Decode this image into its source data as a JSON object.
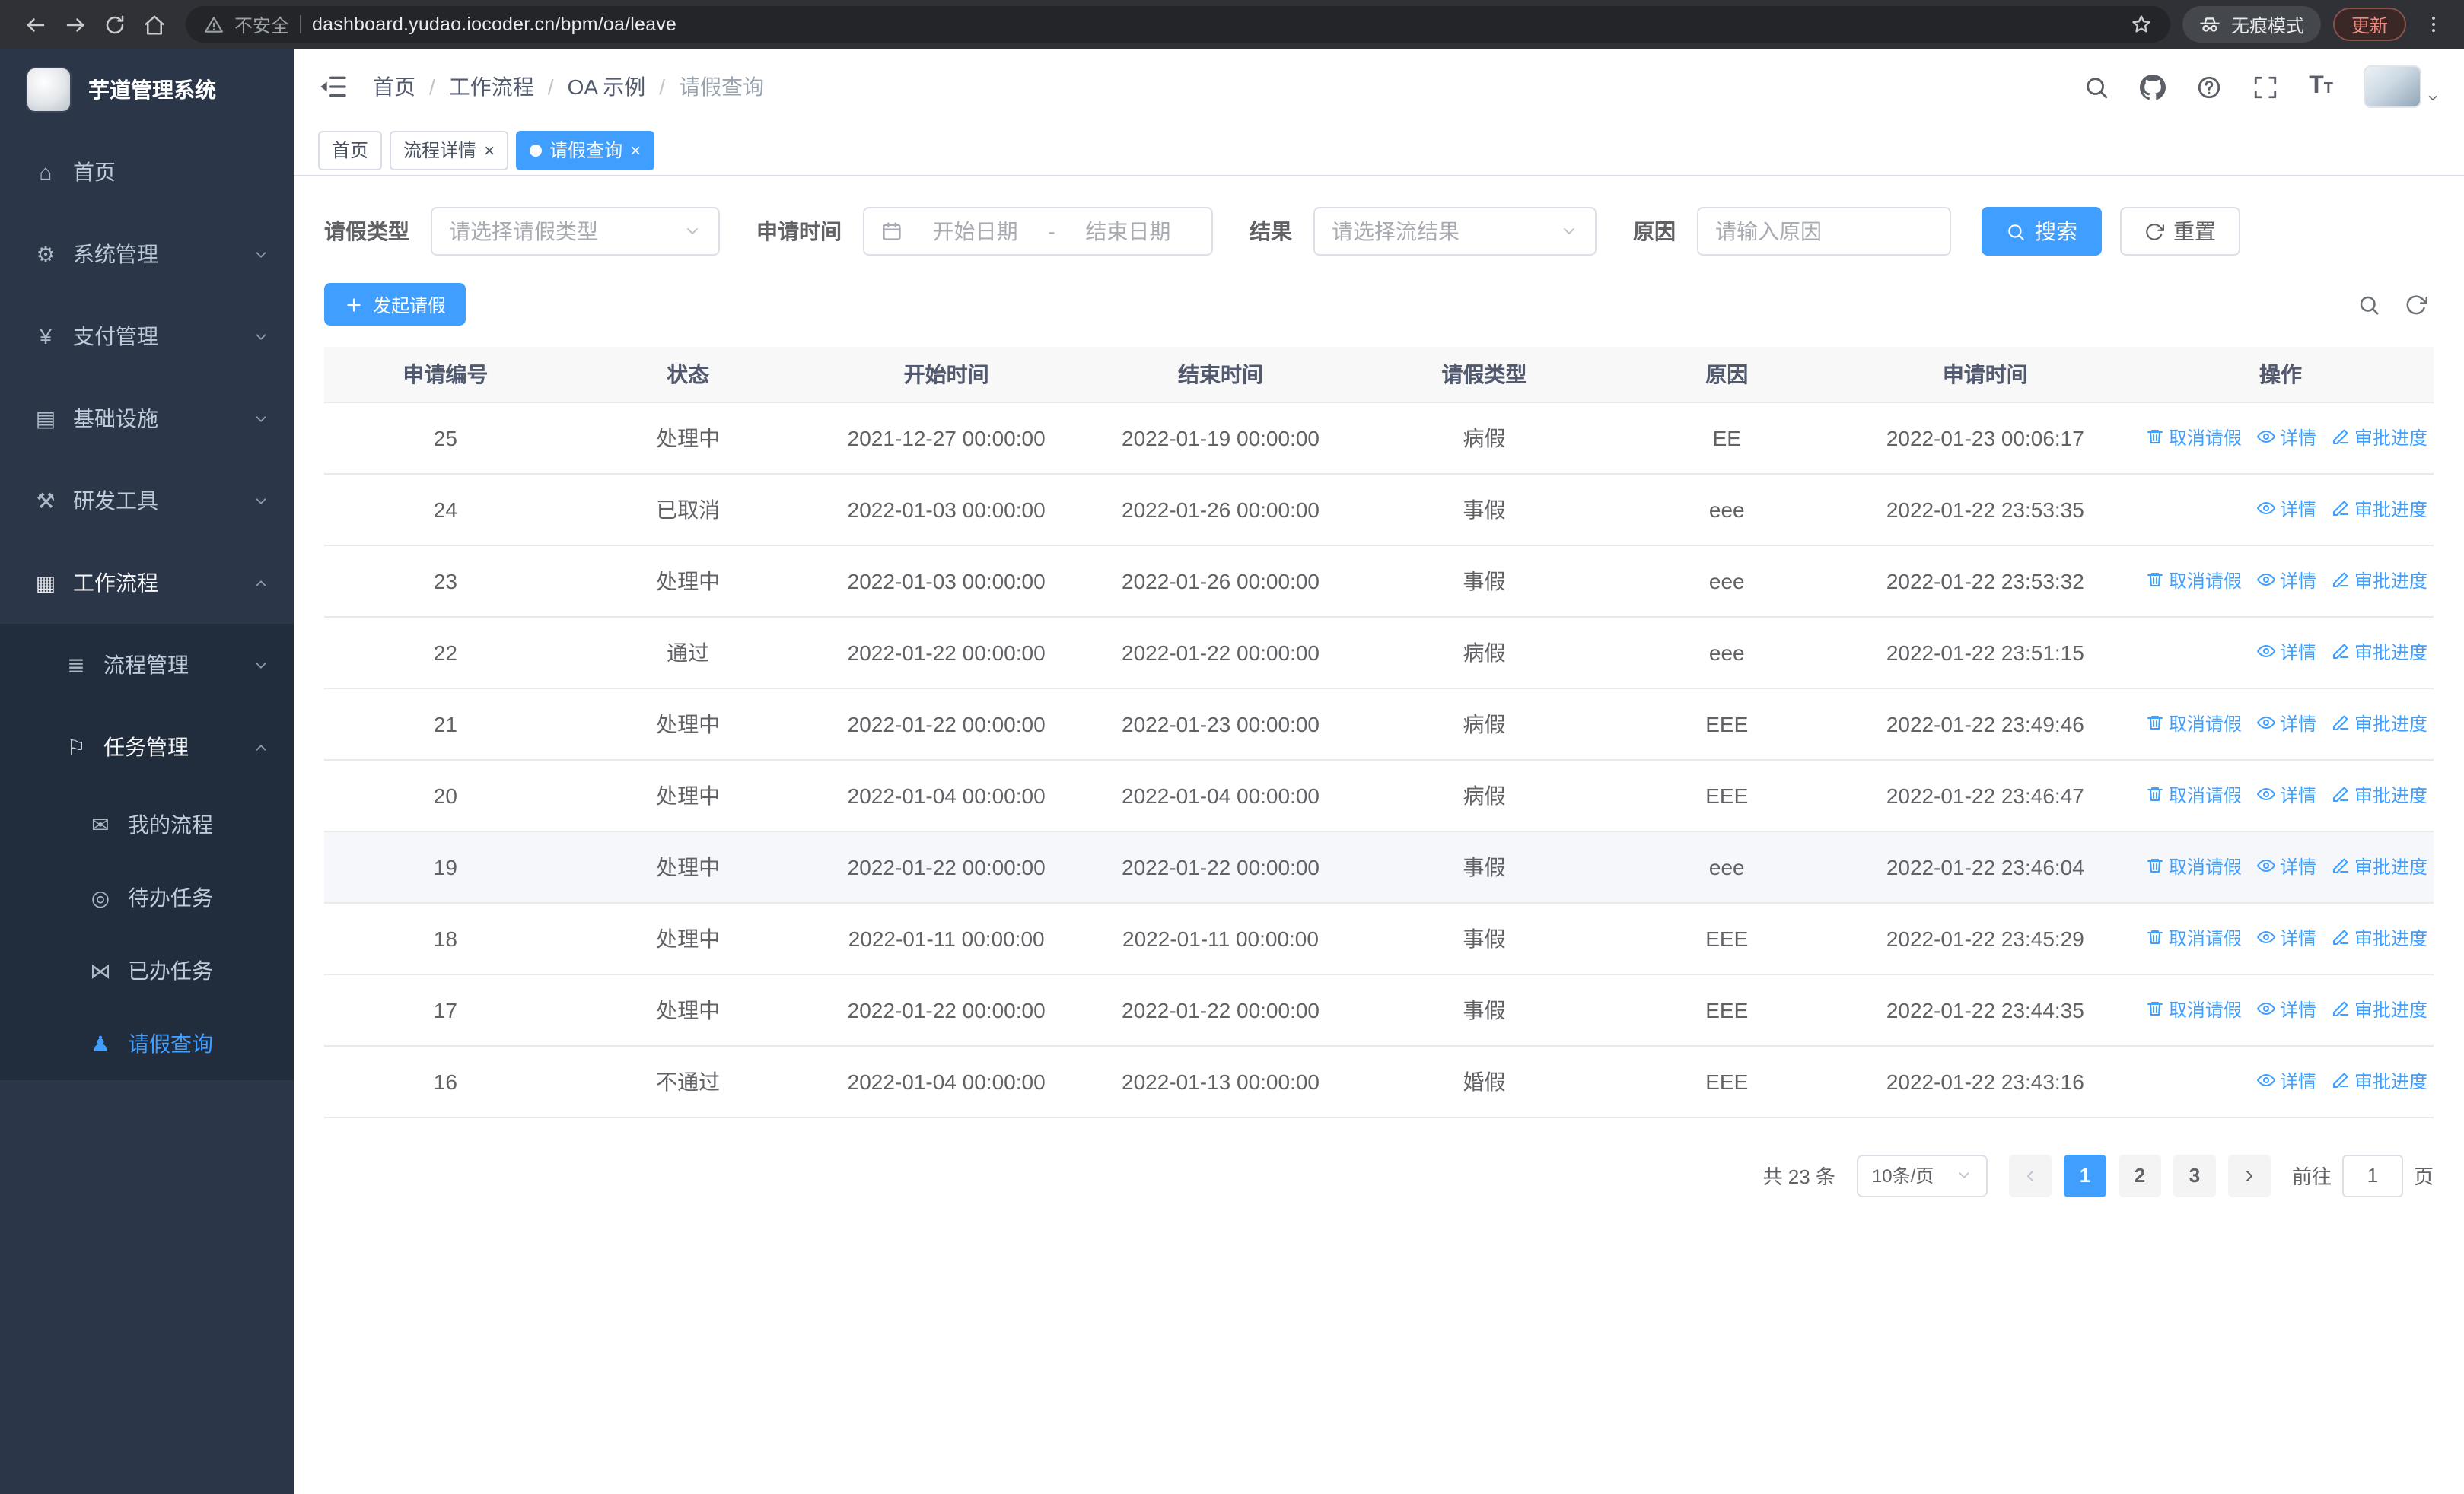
{
  "browser": {
    "url": "dashboard.yudao.iocoder.cn/bpm/oa/leave",
    "security_warning": "不安全",
    "incognito_label": "无痕模式",
    "update_label": "更新"
  },
  "sidebar": {
    "logo_title": "芋道管理系统",
    "items": [
      {
        "key": "home",
        "label": "首页",
        "icon": "home-icon",
        "level": 1
      },
      {
        "key": "system",
        "label": "系统管理",
        "icon": "gear-icon",
        "level": 1,
        "chevron": "down"
      },
      {
        "key": "payment",
        "label": "支付管理",
        "icon": "yen-icon",
        "level": 1,
        "chevron": "down"
      },
      {
        "key": "infra",
        "label": "基础设施",
        "icon": "infra-icon",
        "level": 1,
        "chevron": "down"
      },
      {
        "key": "devtools",
        "label": "研发工具",
        "icon": "tools-icon",
        "level": 1,
        "chevron": "down"
      },
      {
        "key": "workflow",
        "label": "工作流程",
        "icon": "workflow-icon",
        "level": 1,
        "chevron": "up",
        "trail": true
      },
      {
        "key": "process-mgmt",
        "label": "流程管理",
        "icon": "process-icon",
        "level": 2,
        "chevron": "down"
      },
      {
        "key": "task-mgmt",
        "label": "任务管理",
        "icon": "task-icon",
        "level": 2,
        "chevron": "up",
        "trail": true
      },
      {
        "key": "my-process",
        "label": "我的流程",
        "icon": "message-icon",
        "level": 3
      },
      {
        "key": "todo-tasks",
        "label": "待办任务",
        "icon": "eye-circle-icon",
        "level": 3
      },
      {
        "key": "done-tasks",
        "label": "已办任务",
        "icon": "done-icon",
        "level": 3
      },
      {
        "key": "leave-query",
        "label": "请假查询",
        "icon": "user-icon",
        "level": 3,
        "active": true
      }
    ]
  },
  "icons": {
    "home-icon": "⌂",
    "gear-icon": "⚙",
    "yen-icon": "¥",
    "infra-icon": "▤",
    "tools-icon": "⚒",
    "workflow-icon": "▦",
    "process-icon": "≣",
    "task-icon": "⚐",
    "message-icon": "✉",
    "eye-circle-icon": "◎",
    "done-icon": "⋈",
    "user-icon": "♟"
  },
  "header": {
    "breadcrumb": [
      "首页",
      "工作流程",
      "OA 示例",
      "请假查询"
    ]
  },
  "tabs": [
    {
      "label": "首页",
      "closable": false,
      "active": false
    },
    {
      "label": "流程详情",
      "closable": true,
      "active": false
    },
    {
      "label": "请假查询",
      "closable": true,
      "active": true
    }
  ],
  "filters": {
    "leave_type_label": "请假类型",
    "leave_type_placeholder": "请选择请假类型",
    "apply_time_label": "申请时间",
    "start_date_placeholder": "开始日期",
    "date_separator": "-",
    "end_date_placeholder": "结束日期",
    "result_label": "结果",
    "result_placeholder": "请选择流结果",
    "reason_label": "原因",
    "reason_placeholder": "请输入原因",
    "search_button": "搜索",
    "reset_button": "重置"
  },
  "toolbar": {
    "create_button": "发起请假"
  },
  "table": {
    "columns": [
      "申请编号",
      "状态",
      "开始时间",
      "结束时间",
      "请假类型",
      "原因",
      "申请时间",
      "操作"
    ],
    "action_labels": {
      "cancel": "取消请假",
      "detail": "详情",
      "progress": "审批进度"
    },
    "rows": [
      {
        "id": "25",
        "status": "处理中",
        "start": "2021-12-27 00:00:00",
        "end": "2022-01-19 00:00:00",
        "type": "病假",
        "reason": "EE",
        "applied": "2022-01-23 00:06:17",
        "actions": [
          "cancel",
          "detail",
          "progress"
        ],
        "highlighted": false
      },
      {
        "id": "24",
        "status": "已取消",
        "start": "2022-01-03 00:00:00",
        "end": "2022-01-26 00:00:00",
        "type": "事假",
        "reason": "eee",
        "applied": "2022-01-22 23:53:35",
        "actions": [
          "detail",
          "progress"
        ],
        "highlighted": false
      },
      {
        "id": "23",
        "status": "处理中",
        "start": "2022-01-03 00:00:00",
        "end": "2022-01-26 00:00:00",
        "type": "事假",
        "reason": "eee",
        "applied": "2022-01-22 23:53:32",
        "actions": [
          "cancel",
          "detail",
          "progress"
        ],
        "highlighted": false
      },
      {
        "id": "22",
        "status": "通过",
        "start": "2022-01-22 00:00:00",
        "end": "2022-01-22 00:00:00",
        "type": "病假",
        "reason": "eee",
        "applied": "2022-01-22 23:51:15",
        "actions": [
          "detail",
          "progress"
        ],
        "highlighted": false
      },
      {
        "id": "21",
        "status": "处理中",
        "start": "2022-01-22 00:00:00",
        "end": "2022-01-23 00:00:00",
        "type": "病假",
        "reason": "EEE",
        "applied": "2022-01-22 23:49:46",
        "actions": [
          "cancel",
          "detail",
          "progress"
        ],
        "highlighted": false
      },
      {
        "id": "20",
        "status": "处理中",
        "start": "2022-01-04 00:00:00",
        "end": "2022-01-04 00:00:00",
        "type": "病假",
        "reason": "EEE",
        "applied": "2022-01-22 23:46:47",
        "actions": [
          "cancel",
          "detail",
          "progress"
        ],
        "highlighted": false
      },
      {
        "id": "19",
        "status": "处理中",
        "start": "2022-01-22 00:00:00",
        "end": "2022-01-22 00:00:00",
        "type": "事假",
        "reason": "eee",
        "applied": "2022-01-22 23:46:04",
        "actions": [
          "cancel",
          "detail",
          "progress"
        ],
        "highlighted": true
      },
      {
        "id": "18",
        "status": "处理中",
        "start": "2022-01-11 00:00:00",
        "end": "2022-01-11 00:00:00",
        "type": "事假",
        "reason": "EEE",
        "applied": "2022-01-22 23:45:29",
        "actions": [
          "cancel",
          "detail",
          "progress"
        ],
        "highlighted": false
      },
      {
        "id": "17",
        "status": "处理中",
        "start": "2022-01-22 00:00:00",
        "end": "2022-01-22 00:00:00",
        "type": "事假",
        "reason": "EEE",
        "applied": "2022-01-22 23:44:35",
        "actions": [
          "cancel",
          "detail",
          "progress"
        ],
        "highlighted": false
      },
      {
        "id": "16",
        "status": "不通过",
        "start": "2022-01-04 00:00:00",
        "end": "2022-01-13 00:00:00",
        "type": "婚假",
        "reason": "EEE",
        "applied": "2022-01-22 23:43:16",
        "actions": [
          "detail",
          "progress"
        ],
        "highlighted": false
      }
    ]
  },
  "pagination": {
    "total_text": "共 23 条",
    "page_size": "10条/页",
    "pages": [
      "1",
      "2",
      "3"
    ],
    "active_page": "1",
    "goto_prefix": "前往",
    "goto_value": "1",
    "goto_suffix": "页"
  },
  "colors": {
    "accent": "#409eff",
    "sidebar_bg": "#2b3648",
    "submenu_bg": "#212c3c",
    "active_tab_bg": "#409eff"
  }
}
